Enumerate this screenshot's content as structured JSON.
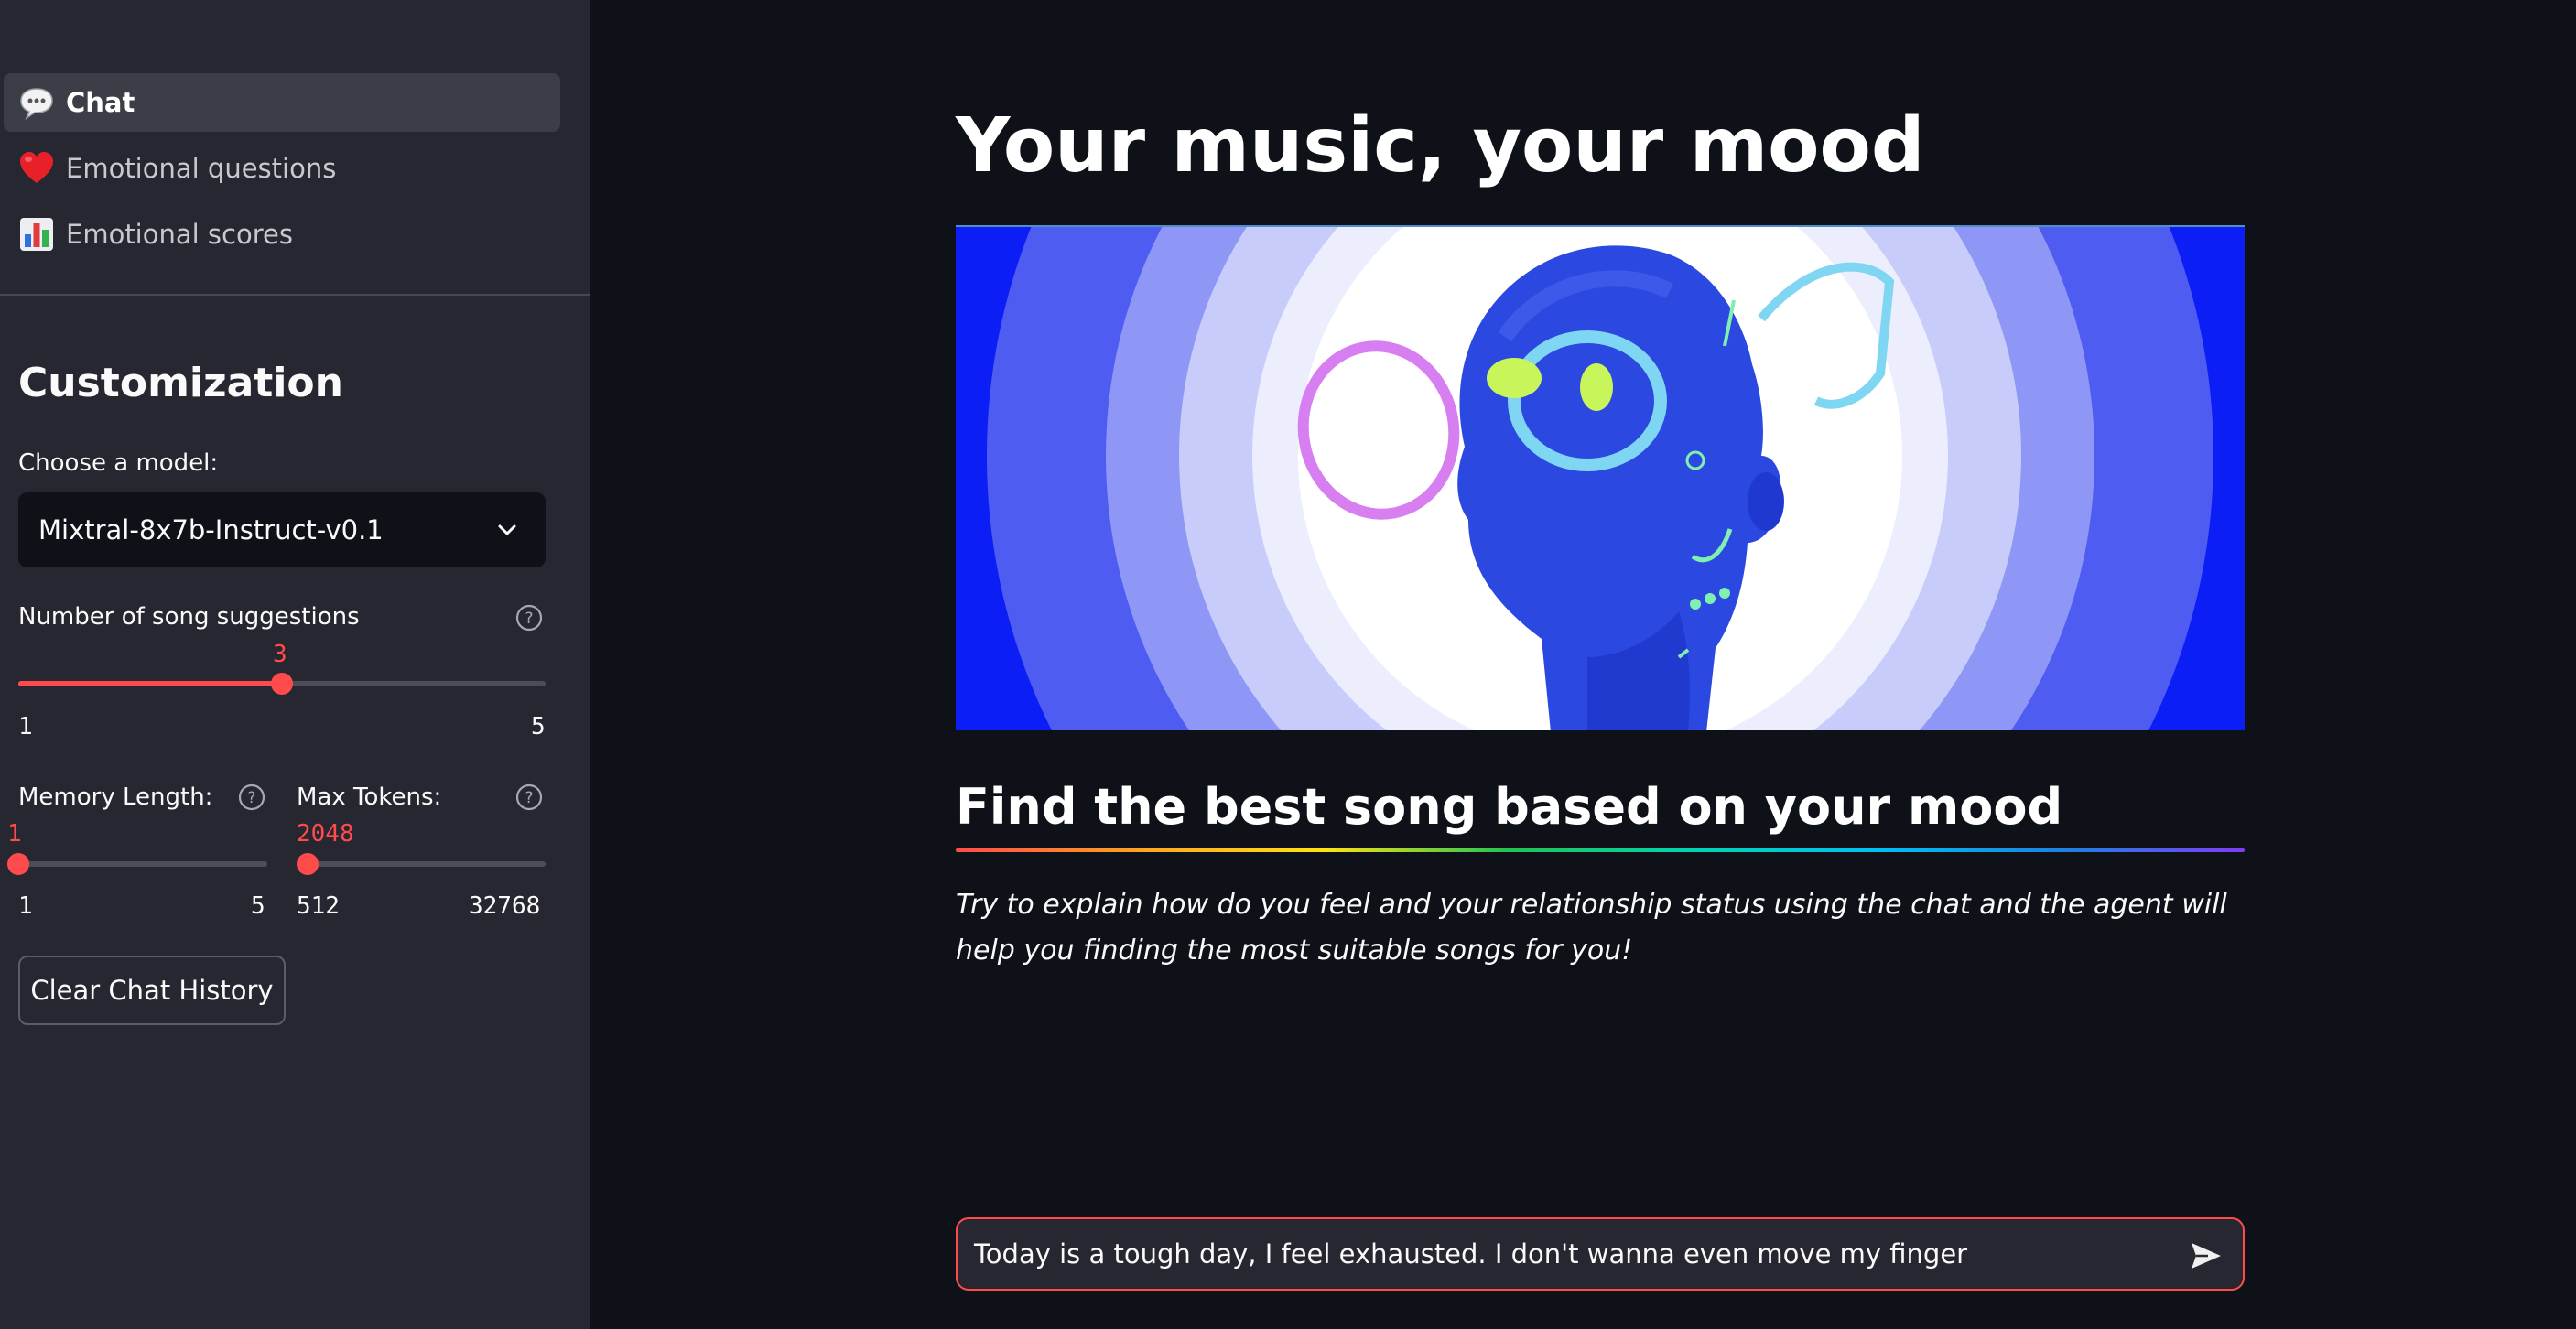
{
  "sidebar": {
    "nav": [
      {
        "label": "Chat",
        "icon": "speech-balloon-icon",
        "active": true
      },
      {
        "label": "Emotional questions",
        "icon": "red-heart-icon",
        "active": false
      },
      {
        "label": "Emotional scores",
        "icon": "bar-chart-icon",
        "active": false
      }
    ],
    "customization": {
      "heading": "Customization",
      "model_label": "Choose a model:",
      "model_value": "Mixtral-8x7b-Instruct-v0.1",
      "songs": {
        "label": "Number of song suggestions",
        "value": "3",
        "min": "1",
        "max": "5"
      },
      "memory": {
        "label": "Memory Length:",
        "value": "1",
        "min": "1",
        "max": "5"
      },
      "tokens": {
        "label": "Max Tokens:",
        "value": "2048",
        "min": "512",
        "max": "32768"
      },
      "clear_button": "Clear Chat History"
    }
  },
  "main": {
    "title": "Your music, your mood",
    "subtitle": "Find the best song based on your mood",
    "intro": "Try to explain how do you feel and your relationship status using the chat and the agent will help you finding the most suitable songs for you!",
    "chat_input": "Today is a tough day, I feel exhausted. I don't wanna even move my finger"
  },
  "colors": {
    "accent": "#ff4b4b",
    "sidebar_bg": "#262730",
    "main_bg": "#0e1117",
    "banner_blue": "#0a1ef5"
  }
}
